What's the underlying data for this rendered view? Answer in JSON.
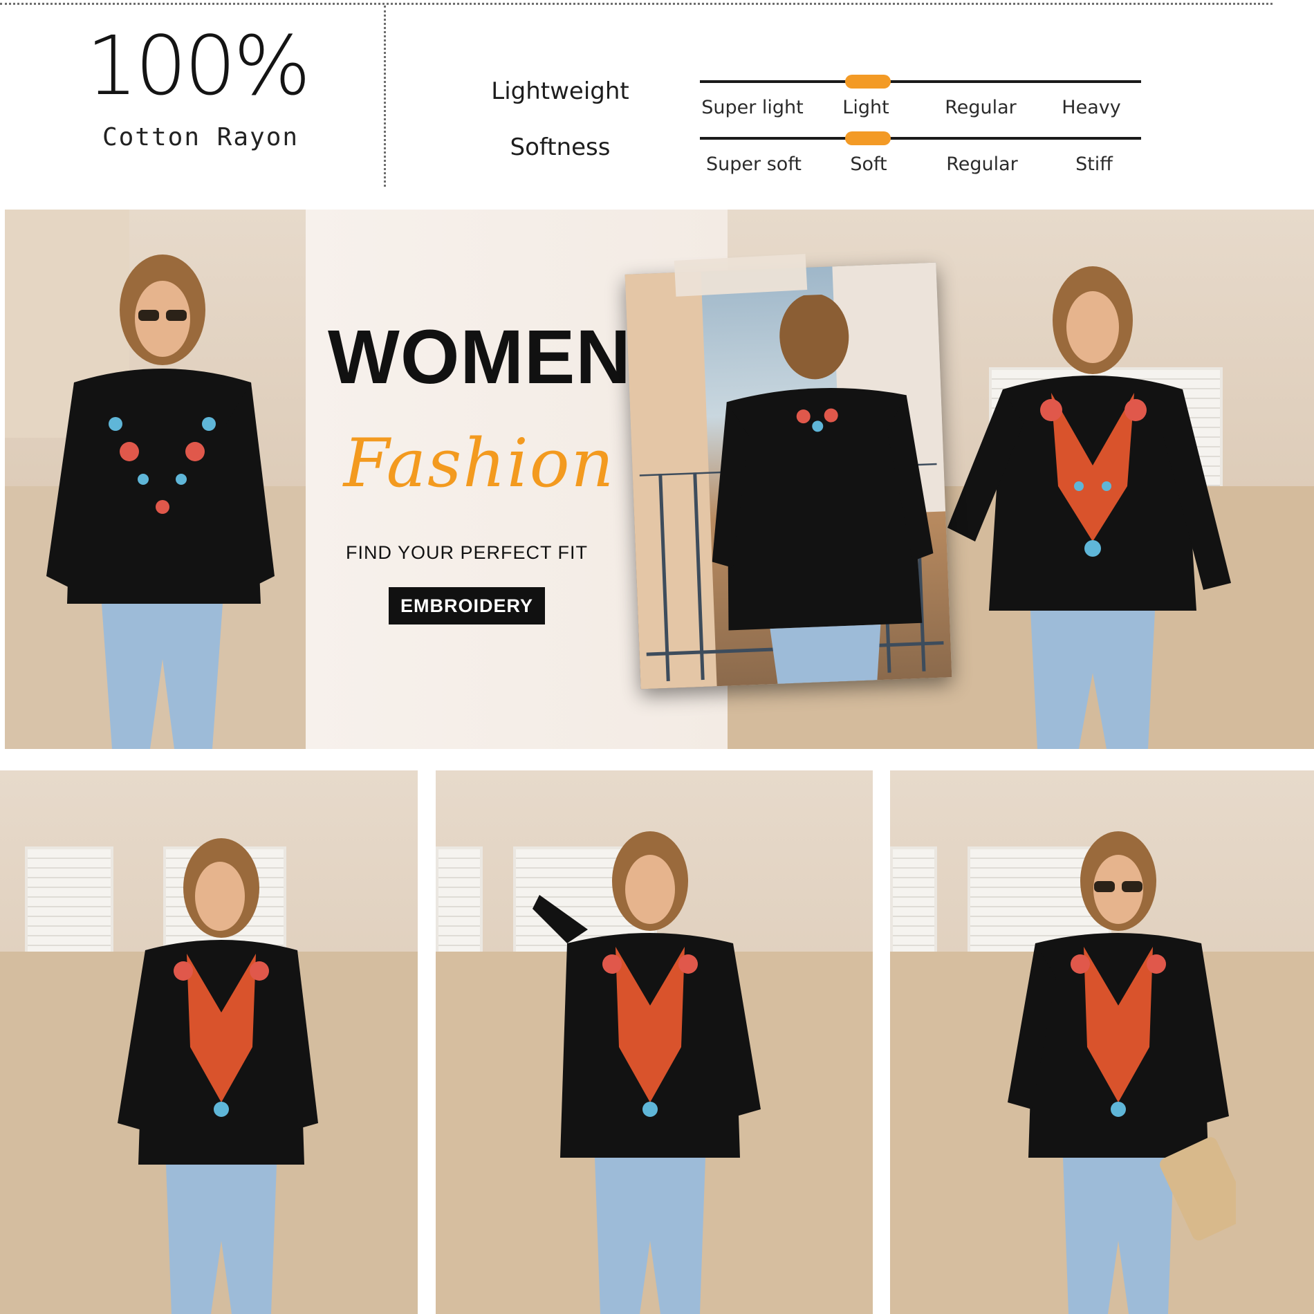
{
  "material": {
    "percent": "100%",
    "fabric": "Cotton Rayon"
  },
  "properties": [
    {
      "label": "Lightweight",
      "scale": [
        "Super light",
        "Light",
        "Regular",
        "Heavy"
      ],
      "selected_index": 1
    },
    {
      "label": "Softness",
      "scale": [
        "Super soft",
        "Soft",
        "Regular",
        "Stiff"
      ],
      "selected_index": 1
    }
  ],
  "hero": {
    "title": "WOMEN",
    "script": "Fashion",
    "tagline": "FIND YOUR PERFECT FIT",
    "button": "EMBROIDERY"
  },
  "colors": {
    "accent": "#f39a25",
    "shirt": "#121212",
    "jeans": "#9dbbd8",
    "wall": "#dccab6"
  }
}
